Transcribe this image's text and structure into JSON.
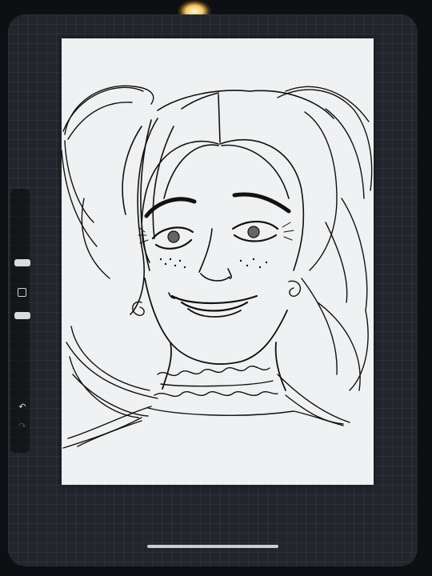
{
  "app": {
    "name": "",
    "screen_theme": "dark",
    "accent_color": "#d9dbde"
  },
  "canvas": {
    "background_color": "#f1f2f3",
    "content": "line-art sketch",
    "ink_color": "#111111"
  },
  "sidebar": {
    "items": [
      {
        "name": "brush-size-slider",
        "icon": "slider-handle"
      },
      {
        "name": "modify-button",
        "icon": "square-outline-icon"
      },
      {
        "name": "opacity-slider",
        "icon": "slider-handle"
      },
      {
        "name": "undo-button",
        "icon": "undo-arrow-icon",
        "glyph": "↶"
      },
      {
        "name": "redo-button",
        "icon": "redo-arrow-icon",
        "glyph": "↷"
      }
    ]
  }
}
